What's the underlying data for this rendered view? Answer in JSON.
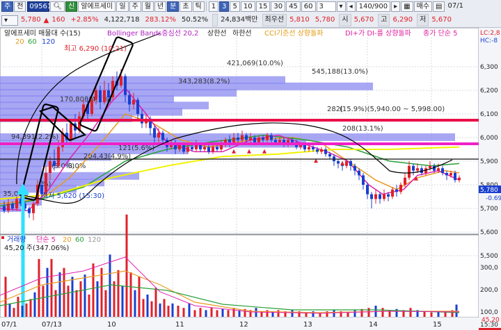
{
  "toolbar": {
    "tab_current": "주",
    "field_jeon": "전",
    "stock_code": "095610",
    "search_icon": "magnifier-icon",
    "new_tag": "신",
    "stock_name": "알에프세미",
    "periods": [
      "일",
      "주",
      "월",
      "년",
      "분",
      "초",
      "틱"
    ],
    "period_selected": "분",
    "intervals": [
      "1",
      "3",
      "5",
      "10",
      "15",
      "30",
      "45",
      "60"
    ],
    "interval_selected": "3",
    "count_value": "3",
    "zoom_value": "140/900",
    "buy_label": "매수",
    "date_right": "07/1",
    "price": "5,780",
    "change_arrow": "▲",
    "change": "160",
    "change_pct": "+2.85%",
    "volume": "4,122,718",
    "vol_ratio": "283.12%",
    "turnover": "50.52%",
    "amount": "24,834백만",
    "priority_ask_label": "최우선",
    "ask": "5,810",
    "bid": "5,780",
    "open_label": "시",
    "open": "5,670",
    "high_label": "고",
    "high": "6,290",
    "low_label": "저",
    "low": "5,670"
  },
  "legend": {
    "title": "알에프세미 매물대 수(15)",
    "bollinger": "Bollinger Bands중심선 20,2",
    "upper": "상한선",
    "lower": "하한선",
    "cci": "CCI기준선 상향돌파",
    "dmi": "DI+가 DI-를 상향돌파",
    "ma": "종가 단순 5",
    "ma_periods": [
      "20",
      "60",
      "120"
    ]
  },
  "annotations": {
    "high_label": "최고 6,290 (10:21)",
    "low_label": "최저 5,620 (15:30)",
    "bands": [
      "421,069(10.0%)",
      "545,188(13.0%)",
      "343,283(8.2%)",
      "170,808(4.1%)",
      "94,391(2.2%)",
      "204,43(4.9%)",
      "121(5.6%)",
      "(15.9%)(5,940.00 ~ 5,998.00)",
      "35,01",
      "3.0%",
      "%)"
    ],
    "band_box_texts": [
      "282(",
      "208(13.1%)",
      "(3.0%)"
    ]
  },
  "right_axis": {
    "top_label_1": "LC:2,8",
    "top_label_2": "HC:-8",
    "ticks": [
      "6,300",
      "6,200",
      "6,100",
      "6,000",
      "5,900",
      "5,800",
      "5,700",
      "5,600",
      "5,500"
    ],
    "current_price_tag": "5,780",
    "pct_tag": "-0.69",
    "vol_ticks": [
      "300,0",
      "200,0",
      "100,0"
    ],
    "vol_tag1": "45,20",
    "vol_tag2": "347,0"
  },
  "volume_panel": {
    "label": "거래량 단순 5 20 60 120",
    "label_parts": [
      "거래량",
      "단순 5",
      "20",
      "60",
      "120"
    ],
    "value": "45,20 주(347.06%)"
  },
  "x_axis": {
    "labels": [
      "07/1",
      "07/13",
      "10",
      "11",
      "12",
      "13",
      "14",
      "15",
      "15:30"
    ]
  },
  "colors": {
    "price_up": "#e0202a",
    "price_down": "#1a3fd0",
    "band": "#8a8af0",
    "ma5": "#e020b0",
    "ma20": "#e89a20",
    "ma60": "#2aa03a",
    "ma120": "#1a3fd0",
    "bollinger": "#111111",
    "annotation_red": "#e0202a",
    "annotation_magenta": "#e020c8",
    "cyan_arrow": "#2fe0ff",
    "yellow_line": "#f2f200"
  }
}
